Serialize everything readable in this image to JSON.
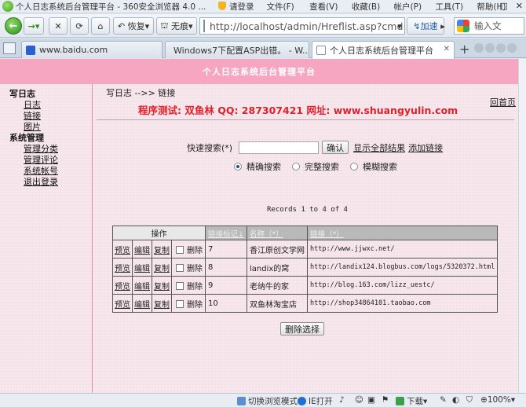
{
  "browser": {
    "title": "个人日志系统后台管理平台 - 360安全浏览器 4.0 ...",
    "login": "请登录",
    "menu": [
      "文件(F)",
      "查看(V)",
      "收藏(B)",
      "帐户(P)",
      "工具(T)",
      "帮助(H)"
    ],
    "toolbar": {
      "restore_label": "恢复",
      "no_trace_label": "无痕",
      "address": "http://localhost/admin/Hreflist.asp?cmd=",
      "accel_label": "加速",
      "search_placeholder": "输入文"
    },
    "tabs": [
      {
        "label": "www.baidu.com",
        "active": false
      },
      {
        "label": "Windows7下配置ASP出错。 - W...",
        "active": false
      },
      {
        "label": "个人日志系统后台管理平台",
        "active": true
      }
    ],
    "status": {
      "mode": "切换浏览模式",
      "ie": "IE打开",
      "download": "下载",
      "zoom": "100%"
    }
  },
  "page": {
    "banner": "个人日志系统后台管理平台",
    "sidebar": {
      "sections": [
        {
          "title": "写日志",
          "items": [
            "日志",
            "链接",
            "图片"
          ]
        },
        {
          "title": "系统管理",
          "items": [
            "管理分类",
            "管理评论",
            "系统帐号",
            "退出登录"
          ]
        }
      ]
    },
    "breadcrumb": "写日志 -->> 链接",
    "home_link": "回首页",
    "tagline": "程序测试: 双鱼林  QQ: 287307421  网址: www.shuangyulin.com",
    "search": {
      "label": "快速搜索(*)",
      "confirm": "确认",
      "show_all": "显示全部结果",
      "add_link": "添加链接",
      "modes": [
        {
          "label": "精确搜索",
          "checked": true
        },
        {
          "label": "完整搜索",
          "checked": false
        },
        {
          "label": "模糊搜索",
          "checked": false
        }
      ]
    },
    "records": "Records 1 to 4 of 4",
    "table": {
      "headers": {
        "ops": "操作",
        "id": "链接标记↓",
        "name": "名称（*）",
        "url": "链接（*）"
      },
      "actions": {
        "preview": "预览",
        "edit": "编辑",
        "copy": "复制",
        "delete": "删除"
      },
      "rows": [
        {
          "id": "7",
          "name": "香江原创文学网",
          "url": "http://www.jjwxc.net/"
        },
        {
          "id": "8",
          "name": "landix的窝",
          "url": "http://landix124.blogbus.com/logs/5320372.html"
        },
        {
          "id": "9",
          "name": "老纳牛的家",
          "url": "http://blog.163.com/lizz_uestc/"
        },
        {
          "id": "10",
          "name": "双鱼林淘宝店",
          "url": "http://shop34864101.taobao.com"
        }
      ]
    },
    "delete_selected": "删除选择"
  }
}
